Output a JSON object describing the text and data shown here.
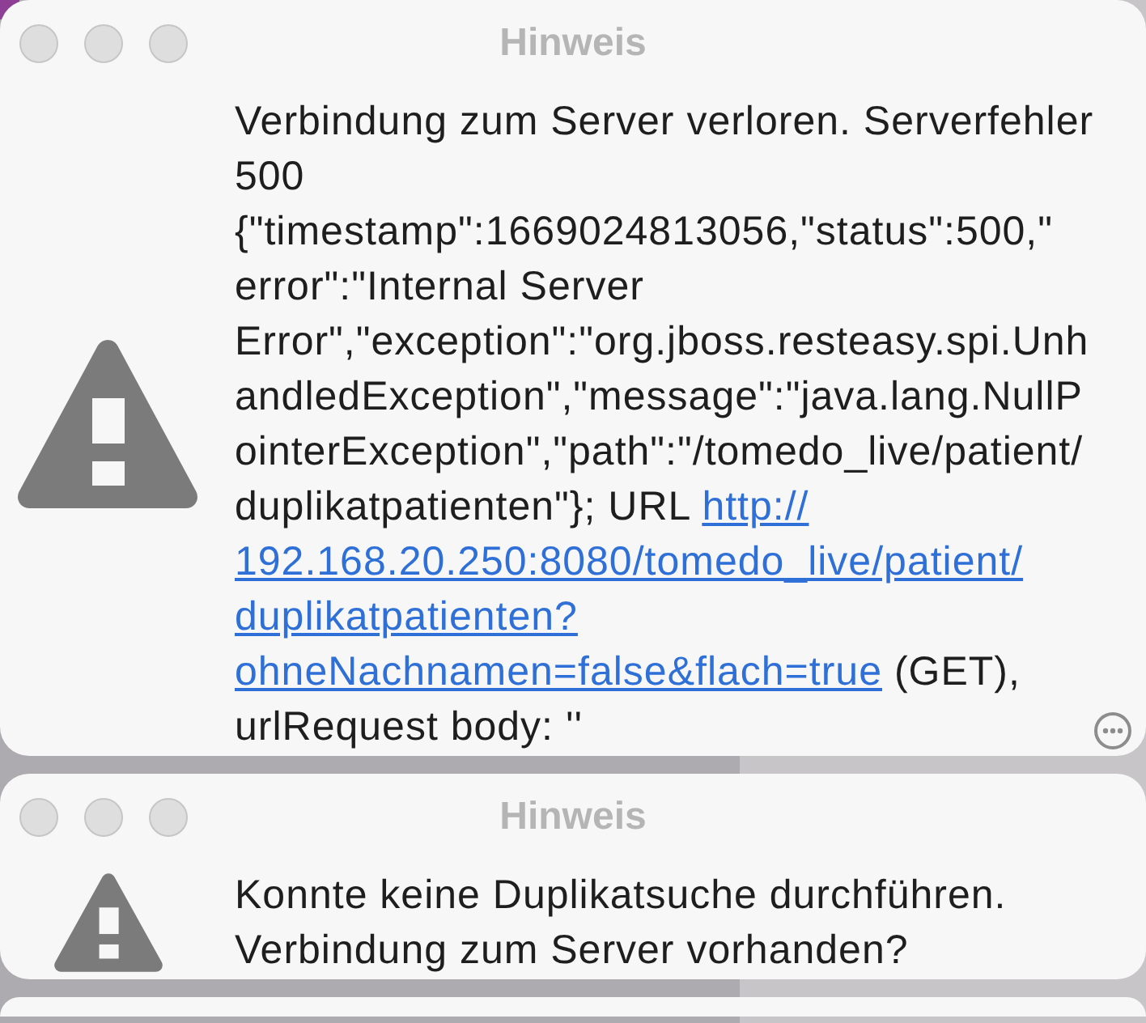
{
  "alerts": [
    {
      "title": "Hinweis",
      "active": false,
      "message_lines": [
        [
          {
            "kind": "text",
            "text": "Verbindung zum Server verloren. Serverfehler"
          }
        ],
        [
          {
            "kind": "text",
            "text": "500"
          }
        ],
        [
          {
            "kind": "text",
            "text": "{\"timestamp\":1669024813056,\"status\":500,\""
          }
        ],
        [
          {
            "kind": "text",
            "text": "error\":\"Internal Server"
          }
        ],
        [
          {
            "kind": "text",
            "text": "Error\",\"exception\":\"org.jboss.resteasy.spi.Unh"
          }
        ],
        [
          {
            "kind": "text",
            "text": "andledException\",\"message\":\"java.lang.NullP"
          }
        ],
        [
          {
            "kind": "text",
            "text": "ointerException\",\"path\":\"/tomedo_live/patient/"
          }
        ],
        [
          {
            "kind": "text",
            "text": "duplikatpatienten\"}; URL "
          },
          {
            "kind": "link",
            "text": "http://"
          }
        ],
        [
          {
            "kind": "link",
            "text": "192.168.20.250:8080/tomedo_live/patient/"
          }
        ],
        [
          {
            "kind": "link",
            "text": "duplikatpatienten?"
          }
        ],
        [
          {
            "kind": "link",
            "text": "ohneNachnamen=false&flach=true"
          },
          {
            "kind": "text",
            "text": " (GET),"
          }
        ],
        [
          {
            "kind": "text",
            "text": "urlRequest body: ''"
          }
        ]
      ],
      "options_button": true
    },
    {
      "title": "Hinweis",
      "active": false,
      "message_lines": [
        [
          {
            "kind": "text",
            "text": "Konnte keine Duplikatsuche durchführen."
          }
        ],
        [
          {
            "kind": "text",
            "text": "Verbindung zum Server vorhanden?"
          }
        ]
      ],
      "options_button": false
    }
  ]
}
